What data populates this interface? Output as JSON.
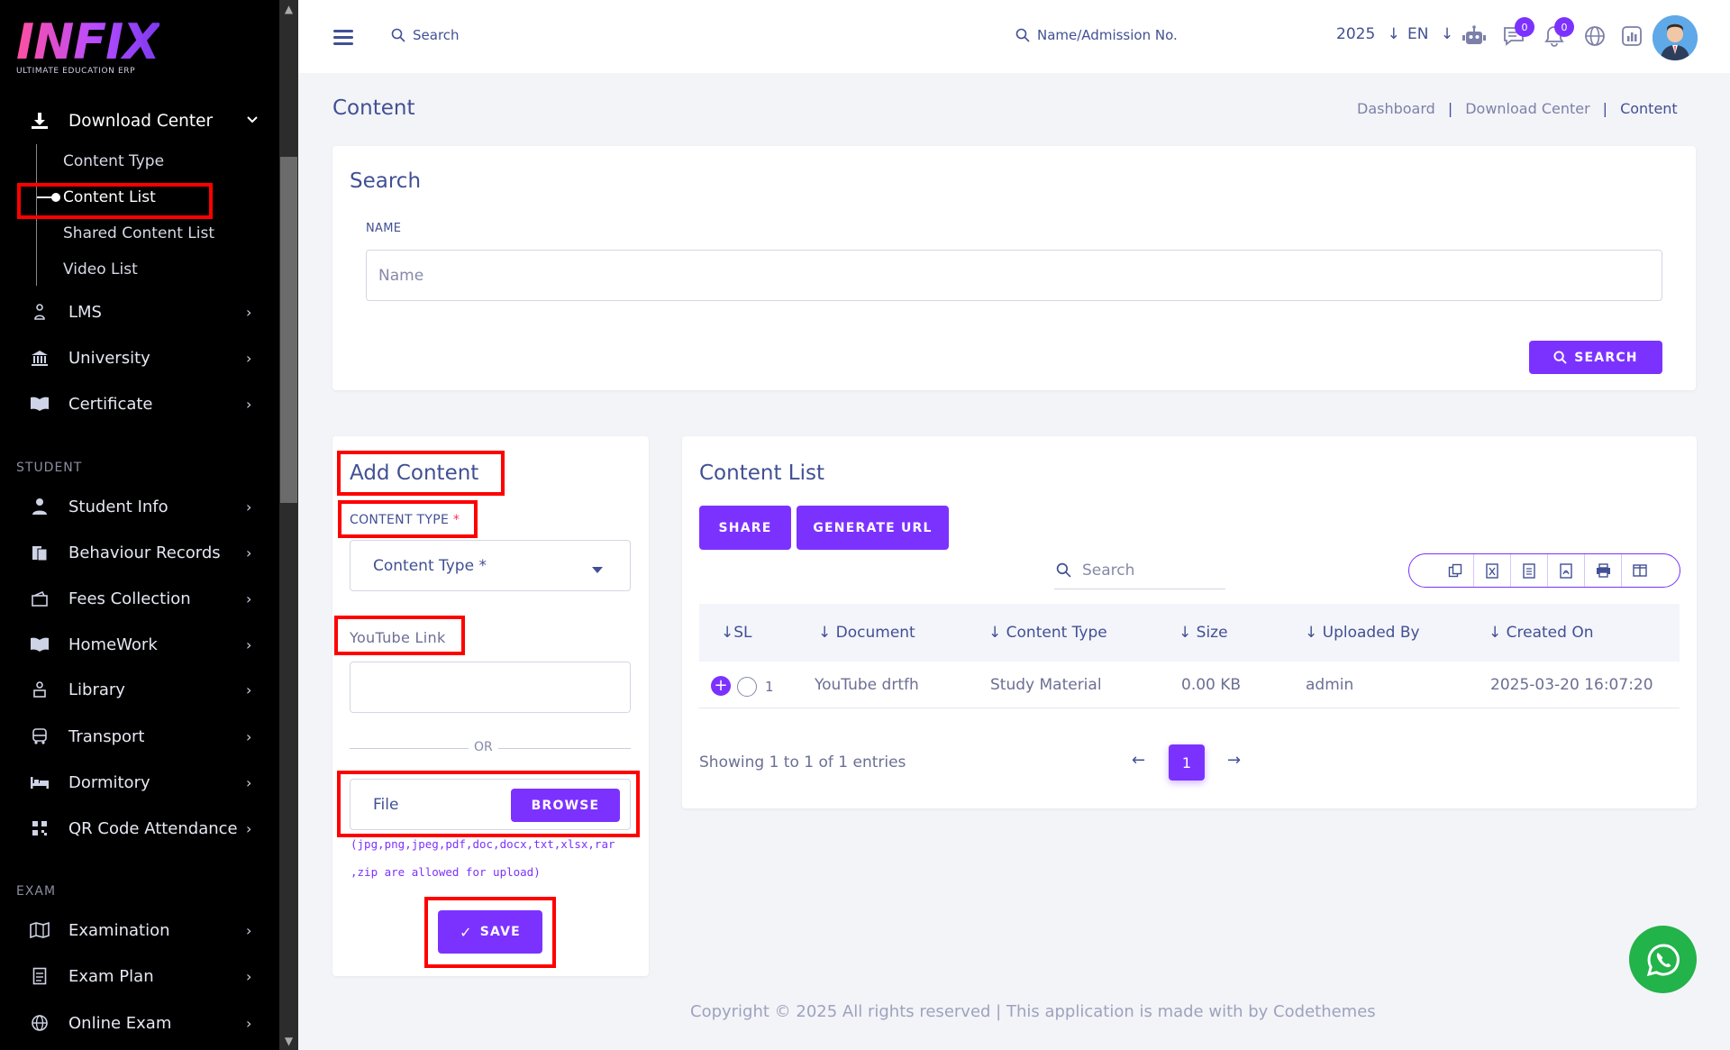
{
  "brand": {
    "logo_text": "INFIX",
    "tagline": "ULTIMATE EDUCATION ERP"
  },
  "sidebar": {
    "download_center": "Download Center",
    "sub_items": [
      "Content Type",
      "Content List",
      "Shared Content List",
      "Video List"
    ],
    "items_top": [
      "LMS",
      "University",
      "Certificate"
    ],
    "section_student": "STUDENT",
    "items_student": [
      "Student Info",
      "Behaviour Records",
      "Fees Collection",
      "HomeWork",
      "Library",
      "Transport",
      "Dormitory",
      "QR Code Attendance"
    ],
    "section_exam": "EXAM",
    "items_exam": [
      "Examination",
      "Exam Plan",
      "Online Exam"
    ]
  },
  "topbar": {
    "search_label": "Search",
    "admission_search": "Name/Admission No.",
    "year": "2025",
    "lang": "EN",
    "chat_badge": "0",
    "notif_badge": "0"
  },
  "page": {
    "title": "Content",
    "breadcrumb": [
      "Dashboard",
      "Download Center",
      "Content"
    ]
  },
  "search_card": {
    "title": "Search",
    "name_label": "NAME",
    "name_placeholder": "Name",
    "search_button": "SEARCH"
  },
  "add_content": {
    "title": "Add Content",
    "content_type_label": "CONTENT TYPE",
    "required_mark": "*",
    "content_type_select": "Content Type *",
    "youtube_label": "YouTube Link",
    "or_text": "OR",
    "file_placeholder": "File",
    "browse_button": "BROWSE",
    "allowed_line1": "(jpg,png,jpeg,pdf,doc,docx,txt,xlsx,rar",
    "allowed_line2": ",zip are allowed for upload)",
    "save_button": "SAVE"
  },
  "content_list": {
    "title": "Content List",
    "share_button": "SHARE",
    "generate_url_button": "GENERATE URL",
    "search_placeholder": "Search",
    "columns": [
      "SL",
      "Document",
      "Content Type",
      "Size",
      "Uploaded By",
      "Created On"
    ],
    "rows": [
      {
        "sl": "1",
        "document": "YouTube drtfh",
        "content_type": "Study Material",
        "size": "0.00 KB",
        "uploaded_by": "admin",
        "created_on": "2025-03-20 16:07:20"
      }
    ],
    "showing": "Showing 1 to 1 of 1 entries",
    "current_page": "1"
  },
  "footer": "Copyright © 2025 All rights reserved | This application is made with by Codethemes",
  "colors": {
    "accent": "#7c32ff",
    "text": "#415094",
    "sidebar_bg": "#000000",
    "highlight": "#ff0000",
    "whatsapp": "#22b34a"
  }
}
